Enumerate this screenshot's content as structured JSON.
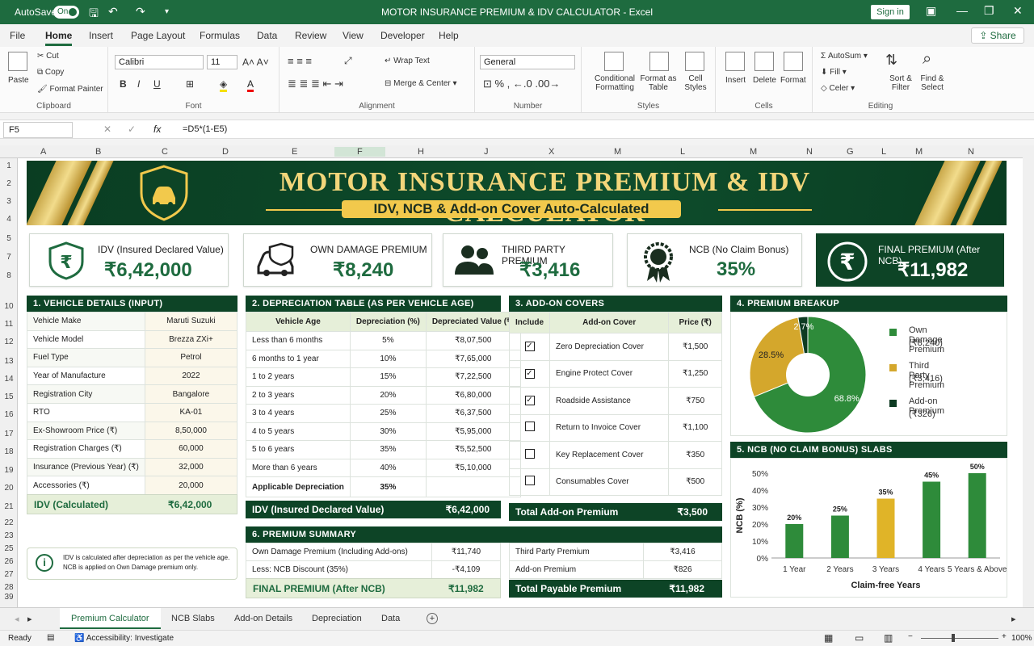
{
  "app": {
    "autosave_label": "AutoSave",
    "autosave_state": "On",
    "title": "MOTOR INSURANCE PREMIUM & IDV CALCULATOR  -  Excel",
    "signin": "Sign in"
  },
  "ribbon_tabs": [
    "File",
    "Home",
    "Insert",
    "Page Layout",
    "Formulas",
    "Data",
    "Review",
    "View",
    "Developer",
    "Help"
  ],
  "share": "Share",
  "ribbon": {
    "clipboard": {
      "paste": "Paste",
      "cut": "Cut",
      "copy": "Copy",
      "format_painter": "Format Painter",
      "group": "Clipboard"
    },
    "font": {
      "name": "Calibri",
      "size": "11",
      "group": "Font"
    },
    "alignment": {
      "wrap": "Wrap Text",
      "merge": "Merge & Center",
      "group": "Alignment"
    },
    "number": {
      "format": "General",
      "group": "Number"
    },
    "styles": {
      "cond": "Conditional Formatting",
      "fmt_table": "Format as Table",
      "cell_styles": "Cell Styles",
      "group": "Styles"
    },
    "cells": {
      "insert": "Insert",
      "delete": "Delete",
      "format": "Format",
      "group": "Cells"
    },
    "editing": {
      "autosum": "AutoSum",
      "fill": "Fill",
      "clear": "Celer",
      "sort": "Sort & Filter",
      "find": "Find & Select",
      "group": "Editing"
    }
  },
  "formula_bar": {
    "cell": "F5",
    "fx": "fx",
    "formula": "=D5*(1-E5)"
  },
  "columns": [
    [
      "A",
      54
    ],
    [
      "B",
      122
    ],
    [
      "C",
      204
    ],
    [
      "D",
      279
    ],
    [
      "E",
      365
    ],
    [
      "F",
      446
    ],
    [
      "H",
      521
    ],
    [
      "J",
      603
    ],
    [
      "X",
      683
    ],
    [
      "M",
      764
    ],
    [
      "L",
      846
    ],
    [
      "M",
      932
    ],
    [
      "N",
      1002
    ],
    [
      "G",
      1052
    ],
    [
      "L",
      1095
    ],
    [
      "M",
      1137
    ],
    [
      "N",
      1202
    ]
  ],
  "rows": [
    "1",
    "2",
    "3",
    "4",
    "5",
    "7",
    "8",
    "10",
    "11",
    "12",
    "13",
    "14",
    "15",
    "16",
    "17",
    "18",
    "19",
    "20",
    "21",
    "22",
    "23",
    "25",
    "26",
    "27",
    "28",
    "39"
  ],
  "banner": {
    "title": "MOTOR INSURANCE PREMIUM & IDV CALCULATOR",
    "subtitle": "IDV, NCB & Add-on Cover Auto-Calculated"
  },
  "kpis": [
    {
      "label": "IDV (Insured Declared Value)",
      "value": "₹6,42,000"
    },
    {
      "label": "OWN DAMAGE PREMIUM",
      "value": "₹8,240"
    },
    {
      "label": "THIRD PARTY PREMIUM",
      "value": "₹3,416"
    },
    {
      "label": "NCB (No Claim Bonus)",
      "value": "35%"
    },
    {
      "label": "FINAL PREMIUM (After NCB)",
      "value": "₹11,982"
    }
  ],
  "vehicle": {
    "header": "1. VEHICLE DETAILS (INPUT)",
    "rows": [
      [
        "Vehicle Make",
        "Maruti Suzuki"
      ],
      [
        "Vehicle Model",
        "Brezza ZXi+"
      ],
      [
        "Fuel Type",
        "Petrol"
      ],
      [
        "Year of Manufacture",
        "2022"
      ],
      [
        "Registration City",
        "Bangalore"
      ],
      [
        "RTO",
        "KA-01"
      ],
      [
        "Ex-Showroom Price (₹)",
        "8,50,000"
      ],
      [
        "Registration Charges (₹)",
        "60,000"
      ],
      [
        "Insurance (Previous Year) (₹)",
        "32,000"
      ],
      [
        "Accessories (₹)",
        "20,000"
      ]
    ],
    "idv_label": "IDV (Calculated)",
    "idv_value": "₹6,42,000"
  },
  "note": "IDV is calculated after depreciation as per the vehicle age. NCB is applied on Own Damage premium only.",
  "depreciation": {
    "header": "2. DEPRECIATION TABLE (AS PER VEHICLE AGE)",
    "cols": [
      "Vehicle Age",
      "Depreciation (%)",
      "Depreciated Value (₹)"
    ],
    "rows": [
      [
        "Less than 6 months",
        "5%",
        "₹8,07,500"
      ],
      [
        "6 months to 1 year",
        "10%",
        "₹7,65,000"
      ],
      [
        "1 to 2 years",
        "15%",
        "₹7,22,500"
      ],
      [
        "2 to 3 years",
        "20%",
        "₹6,80,000"
      ],
      [
        "3 to 4 years",
        "25%",
        "₹6,37,500"
      ],
      [
        "4 to 5 years",
        "30%",
        "₹5,95,000"
      ],
      [
        "5 to 6 years",
        "35%",
        "₹5,52,500"
      ],
      [
        "More than 6 years",
        "40%",
        "₹5,10,000"
      ]
    ],
    "applicable_label": "Applicable Depreciation",
    "applicable_value": "35%",
    "total_label": "IDV (Insured Declared Value)",
    "total_value": "₹6,42,000"
  },
  "addons": {
    "header": "3. ADD-ON COVERS",
    "cols": [
      "Include",
      "Add-on Cover",
      "Price (₹)"
    ],
    "rows": [
      [
        true,
        "Zero Depreciation Cover",
        "₹1,500"
      ],
      [
        true,
        "Engine Protect Cover",
        "₹1,250"
      ],
      [
        true,
        "Roadside Assistance",
        "₹750"
      ],
      [
        false,
        "Return to Invoice Cover",
        "₹1,100"
      ],
      [
        false,
        "Key Replacement Cover",
        "₹350"
      ],
      [
        false,
        "Consumables Cover",
        "₹500"
      ]
    ],
    "total_label": "Total Add-on Premium",
    "total_value": "₹3,500"
  },
  "summary": {
    "header": "6. PREMIUM SUMMARY",
    "left": [
      [
        "Own Damage Premium (Including Add-ons)",
        "₹11,740"
      ],
      [
        "Less: NCB Discount (35%)",
        "-₹4,109"
      ]
    ],
    "left_total": [
      "FINAL PREMIUM (After NCB)",
      "₹11,982"
    ],
    "right": [
      [
        "Third Party Premium",
        "₹3,416"
      ],
      [
        "Add-on Premium",
        "₹826"
      ]
    ],
    "right_total": [
      "Total Payable Premium",
      "₹11,982"
    ]
  },
  "chart_data": [
    {
      "type": "pie",
      "title": "4. PREMIUM BREAKUP",
      "series": [
        {
          "name": "Own Damage Premium",
          "label": "(₹8,240)",
          "percent": 68.8,
          "color": "#2e8b3a"
        },
        {
          "name": "Third Party Premium",
          "label": "(₹3,416)",
          "percent": 28.5,
          "color": "#d4a72c"
        },
        {
          "name": "Add-on Premium",
          "label": "(₹326)",
          "percent": 2.7,
          "color": "#0d3b22"
        }
      ]
    },
    {
      "type": "bar",
      "title": "5. NCB (NO CLAIM BONUS) SLABS",
      "categories": [
        "1 Year",
        "2 Years",
        "3 Years",
        "4 Years",
        "5 Years & Above"
      ],
      "values": [
        20,
        25,
        35,
        45,
        50
      ],
      "colors": [
        "#2e8b3a",
        "#2e8b3a",
        "#e0b428",
        "#2e8b3a",
        "#2e8b3a"
      ],
      "ylabel": "NCB (%)",
      "xlabel": "Claim-free Years",
      "ylim": [
        0,
        50
      ],
      "yticks": [
        "0%",
        "10%",
        "20%",
        "30%",
        "40%",
        "50%"
      ],
      "data_labels": [
        "20%",
        "25%",
        "35%",
        "45%",
        "50%"
      ]
    }
  ],
  "sheet_tabs": [
    "Premium Calculator",
    "NCB Slabs",
    "Add-on Details",
    "Depreciation",
    "Data"
  ],
  "status": {
    "ready": "Ready",
    "accessibility": "Accessibility: Investigate",
    "zoom": "100%"
  }
}
